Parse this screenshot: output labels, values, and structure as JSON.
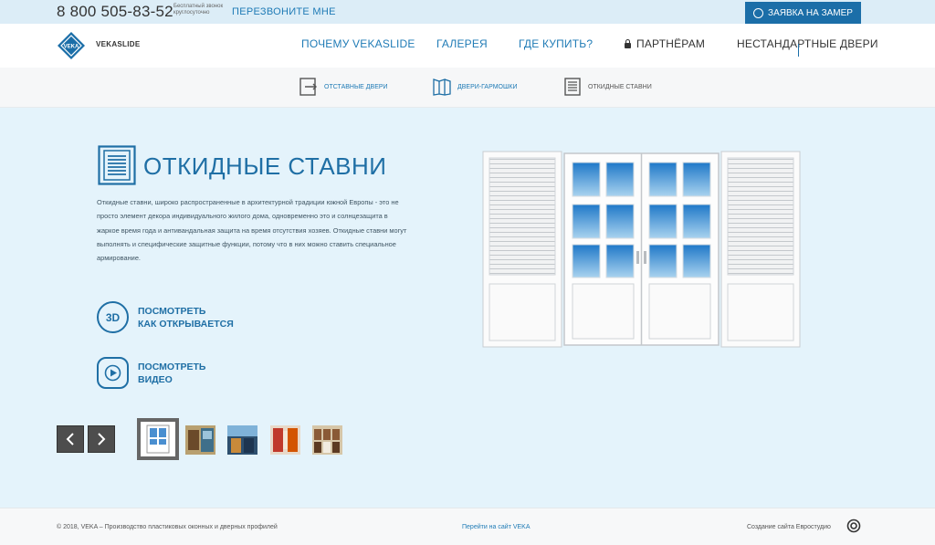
{
  "topbar": {
    "phone": "8 800 505-83-52",
    "phone_note": "Бесплатный звонок круглосуточно",
    "callback": "ПЕРЕЗВОНИТЕ МНЕ",
    "order_button": "ЗАЯВКА НА ЗАМЕР"
  },
  "header": {
    "brand": "VEKASLIDE",
    "nav": [
      {
        "label": "ПОЧЕМУ VEKASLIDE"
      },
      {
        "label": "ГАЛЕРЕЯ"
      },
      {
        "label": "ГДЕ КУПИТЬ?"
      },
      {
        "label": "ПАРТНЁРАМ"
      },
      {
        "label": "НЕСТАНДАРТНЫЕ ДВЕРИ"
      }
    ]
  },
  "subnav": [
    {
      "label": "ОТСТАВНЫЕ ДВЕРИ",
      "icon": "sliding-door-icon"
    },
    {
      "label": "ДВЕРИ-ГАРМОШКИ",
      "icon": "folding-door-icon"
    },
    {
      "label": "ОТКИДНЫЕ СТАВНИ",
      "icon": "shutter-icon"
    }
  ],
  "main": {
    "title": "ОТКИДНЫЕ СТАВНИ",
    "description": "Откидные ставни, широко распространенные в архитектурной традиции южной Европы - это не просто элемент декора индивидуального жилого дома, одновременно это и солнцезащита в жаркое время года и антивандальная защита на время отсутствия хозяев. Откидные ставни могут выполнять и специфические защитные функции, потому что в них можно ставить специальное армирование.",
    "action_3d": {
      "line1": "ПОСМОТРЕТЬ",
      "line2": "КАК ОТКРЫВАЕТСЯ",
      "icon_text": "3D"
    },
    "action_video": {
      "line1": "ПОСМОТРЕТЬ",
      "line2": "ВИДЕО"
    }
  },
  "gallery": {
    "prev": "‹",
    "next": "›"
  },
  "footer": {
    "copyright": "© 2018, VEKA – Производство пластиковых оконных и дверных профилей",
    "link": "Перейти на сайт VEKA",
    "credit": "Создание сайта Евростудио"
  },
  "colors": {
    "accent": "#1f6fa5",
    "order_button": "#1b6ea8",
    "background": "#e4f3fb"
  }
}
